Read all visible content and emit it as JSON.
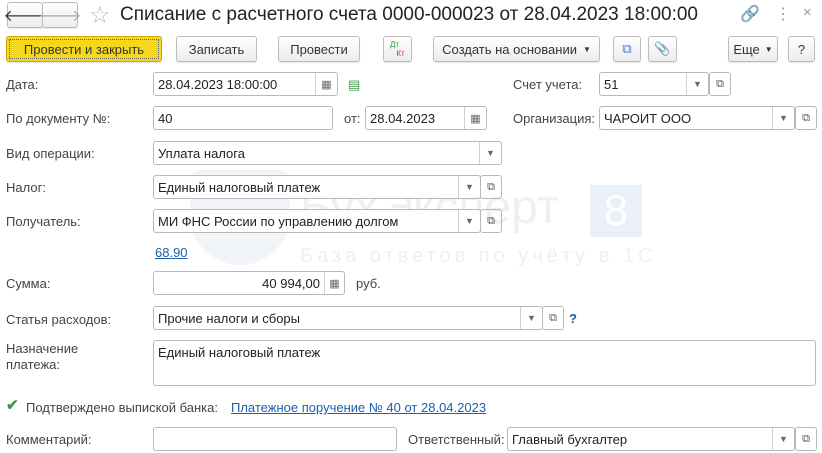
{
  "title": "Списание с расчетного счета 0000-000023 от 28.04.2023 18:00:00",
  "toolbar": {
    "post_close": "Провести и закрыть",
    "save": "Записать",
    "post": "Провести",
    "dtkt_dt": "Дт",
    "dtkt_kt": "Кт",
    "create_based": "Создать на основании",
    "more": "Еще",
    "help": "?"
  },
  "form": {
    "date_label": "Дата:",
    "date": "28.04.2023 18:00:00",
    "account_label": "Счет учета:",
    "account": "51",
    "docnum_label": "По документу №:",
    "docnum": "40",
    "from_label": "от:",
    "docdate": "28.04.2023",
    "org_label": "Организация:",
    "org": "ЧАРОИТ ООО",
    "optype_label": "Вид операции:",
    "optype": "Уплата налога",
    "tax_label": "Налог:",
    "tax": "Единый налоговый платеж",
    "recipient_label": "Получатель:",
    "recipient": "МИ ФНС России по управлению долгом",
    "account_link": "68.90",
    "sum_label": "Сумма:",
    "sum": "40 994,00",
    "currency": "руб.",
    "expense_label": "Статья расходов:",
    "expense": "Прочие налоги и сборы",
    "expense_help": "?",
    "purpose_label": "Назначение платежа:",
    "purpose": "Единый налоговый платеж",
    "confirmed_label": "Подтверждено выпиской банка:",
    "confirmed": true,
    "payment_order_link": "Платежное поручение № 40 от 28.04.2023",
    "comment_label": "Комментарий:",
    "comment": "",
    "responsible_label": "Ответственный:",
    "responsible": "Главный бухгалтер"
  },
  "watermark": {
    "brand": "БухЭксперт",
    "digit": "8",
    "tagline": "База ответов по учёту в 1С"
  }
}
